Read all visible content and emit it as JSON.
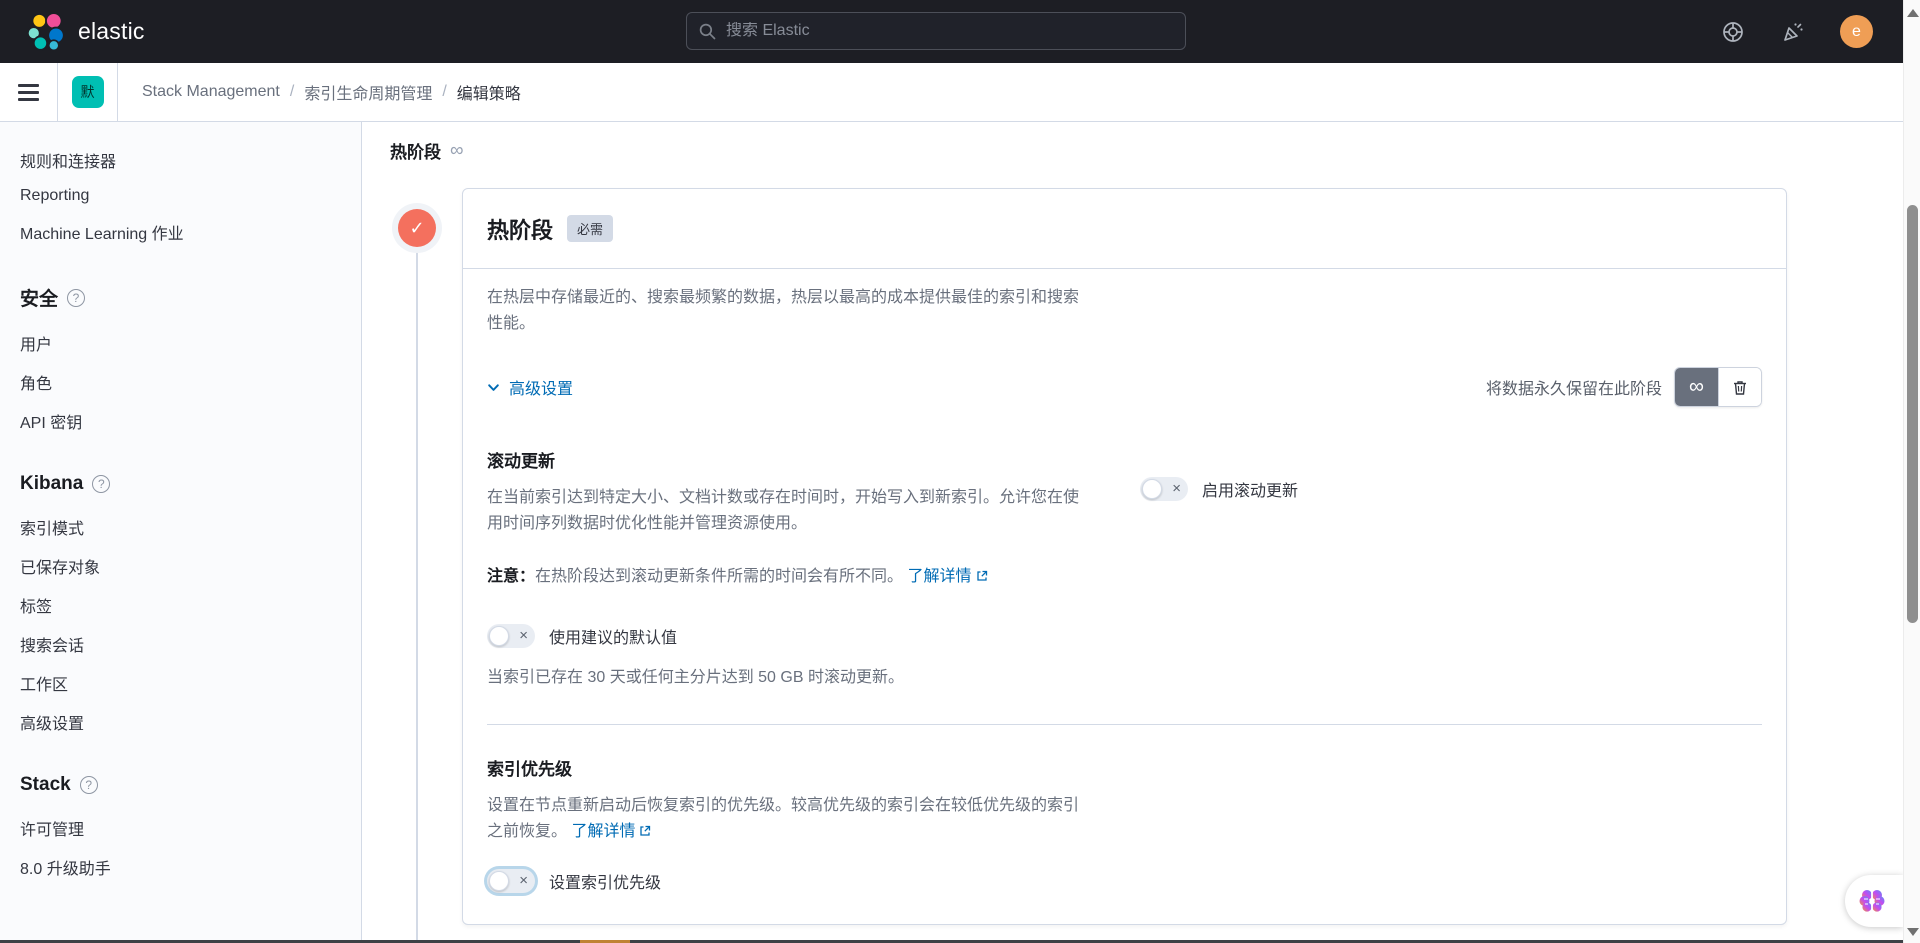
{
  "header": {
    "brand": "elastic",
    "search_placeholder": "搜索 Elastic",
    "avatar_initial": "e"
  },
  "breadcrumb": {
    "space_badge": "默",
    "sep": "/",
    "items": [
      "Stack Management",
      "索引生命周期管理",
      "编辑策略"
    ]
  },
  "sidebar": {
    "groups": [
      {
        "header": null,
        "items": [
          "规则和连接器",
          "Reporting",
          "Machine Learning 作业"
        ]
      },
      {
        "header": "安全",
        "items": [
          "用户",
          "角色",
          "API 密钥"
        ]
      },
      {
        "header": "Kibana",
        "items": [
          "索引模式",
          "已保存对象",
          "标签",
          "搜索会话",
          "工作区",
          "高级设置"
        ]
      },
      {
        "header": "Stack",
        "items": [
          "许可管理",
          "8.0 升级助手"
        ]
      }
    ]
  },
  "main": {
    "page_heading": "热阶段",
    "panel": {
      "title": "热阶段",
      "badge": "必需",
      "description": "在热层中存储最近的、搜索最频繁的数据，热层以最高的成本提供最佳的索引和搜索性能。",
      "advanced_settings_label": "高级设置",
      "keep_data_label": "将数据永久保留在此阶段",
      "rollover": {
        "heading": "滚动更新",
        "description": "在当前索引达到特定大小、文档计数或存在时间时，开始写入到新索引。允许您在使用时间序列数据时优化性能并管理资源使用。",
        "note_label": "注意：",
        "note_text": "在热阶段达到滚动更新条件所需的时间会有所不同。",
        "learn_more": "了解详情",
        "enable_toggle_label": "启用滚动更新",
        "defaults_toggle_label": "使用建议的默认值",
        "defaults_hint": "当索引已存在 30 天或任何主分片达到 50 GB 时滚动更新。"
      },
      "index_priority": {
        "heading": "索引优先级",
        "description": "设置在节点重新启动后恢复索引的优先级。较高优先级的索引会在较低优先级的索引之前恢复。",
        "learn_more": "了解详情",
        "toggle_label": "设置索引优先级"
      }
    }
  },
  "icons": {
    "infinity": "∞",
    "close": "×",
    "check": "✓",
    "help": "?"
  },
  "colors": {
    "header_bg": "#1d1e24",
    "accent_teal": "#00bfb3",
    "hot_phase": "#f4705e",
    "link_blue": "#006bb4",
    "border": "#d3dae6",
    "text_dark": "#343741",
    "text_gray": "#69707d",
    "avatar_orange": "#ef9e55"
  }
}
